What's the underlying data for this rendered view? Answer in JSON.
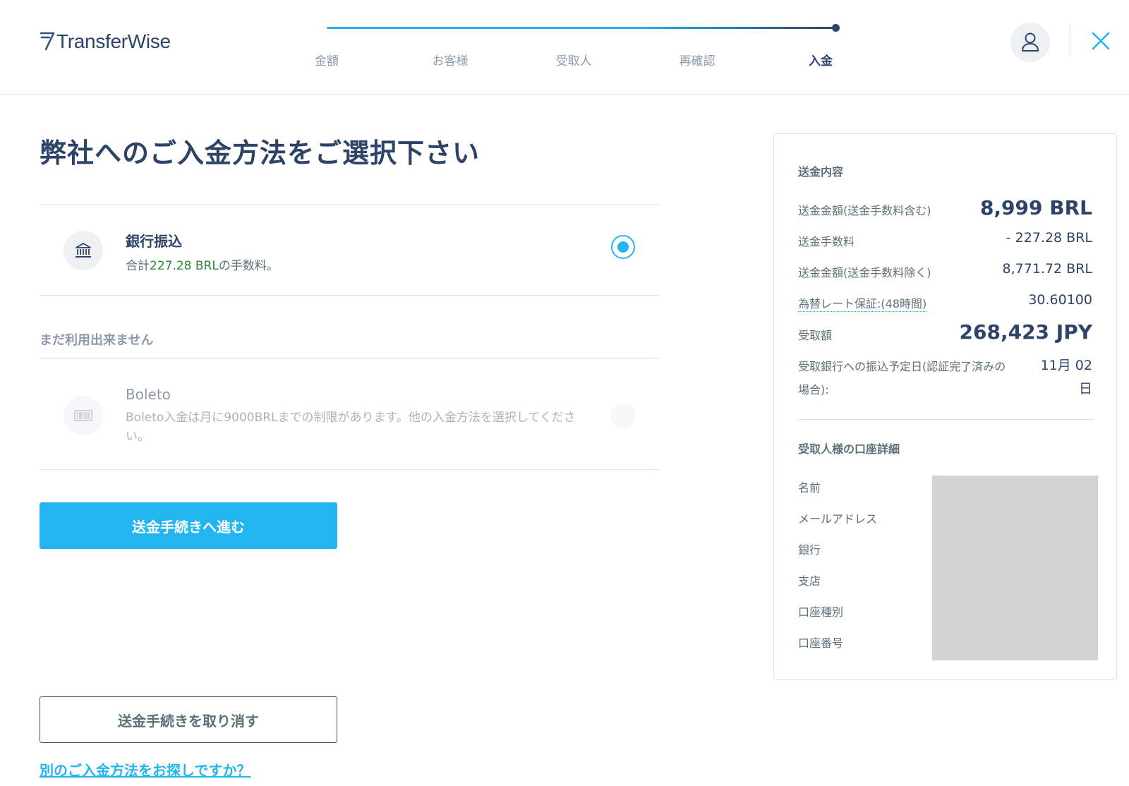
{
  "header": {
    "logo_text": "TransferWise",
    "steps": [
      {
        "label": "金額",
        "active": false
      },
      {
        "label": "お客様",
        "active": false
      },
      {
        "label": "受取人",
        "active": false
      },
      {
        "label": "再確認",
        "active": false
      },
      {
        "label": "入金",
        "active": true
      }
    ],
    "icons": {
      "avatar": "user-icon",
      "close": "close-icon"
    },
    "colors": {
      "accent": "#22b5f0",
      "brand": "#2e4369"
    }
  },
  "main": {
    "title": "弊社へのご入金方法をご選択下さい",
    "bank_option": {
      "title": "銀行振込",
      "desc_prefix": "合計",
      "desc_amount": "227.28 BRL",
      "desc_suffix": "の手数料。",
      "selected": true,
      "icon": "bank-icon"
    },
    "unavailable_label": "まだ利用出来ません",
    "boleto_option": {
      "title": "Boleto",
      "desc": "Boleto入金は月に9000BRLまでの制限があります。他の入金方法を選択してください。",
      "selected": false,
      "icon": "barcode-icon"
    },
    "continue_button": "送金手続きへ進む",
    "cancel_button": "送金手続きを取り消す",
    "alt_link": "別のご入金方法をお探しですか？"
  },
  "summary": {
    "section_title": "送金内容",
    "rows": [
      {
        "label": "送金金額(送金手数料含む)",
        "value": "8,999 BRL"
      },
      {
        "label": "送金手数料",
        "value": "- 227.28 BRL"
      },
      {
        "label": "送金金額(送金手数料除く)",
        "value": "8,771.72 BRL"
      },
      {
        "label": "為替レート保証:(48時間)",
        "value": "30.60100"
      },
      {
        "label": "受取額",
        "value": "268,423 JPY"
      }
    ],
    "delivery": {
      "label_line1": "受取銀行への振込予定日(認証完了済みの",
      "label_line2": "場合):",
      "value_line1": "11月 02",
      "value_line2": "日"
    },
    "recipient_title": "受取人様の口座詳細",
    "recipient_labels": [
      "名前",
      "メールアドレス",
      "銀行",
      "支店",
      "口座種別",
      "口座番号"
    ]
  }
}
